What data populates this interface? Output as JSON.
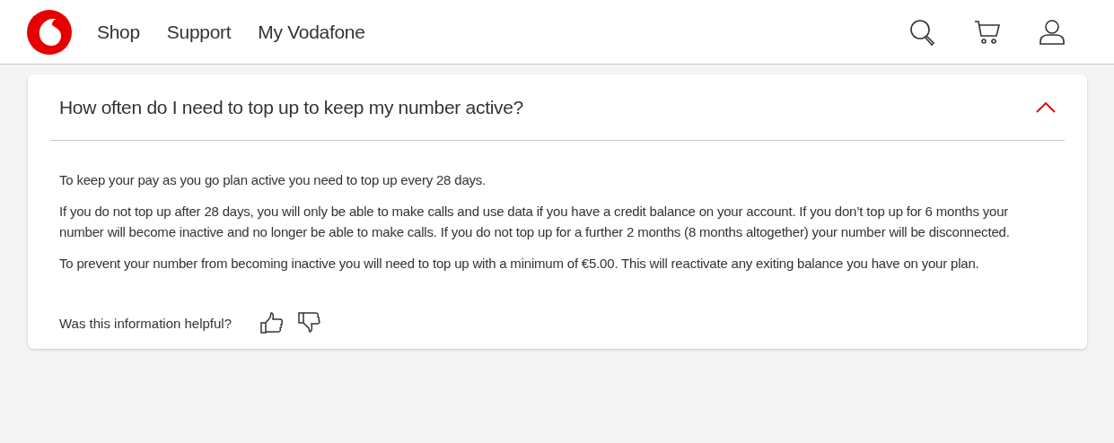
{
  "nav": {
    "links": [
      "Shop",
      "Support",
      "My Vodafone"
    ]
  },
  "faq": {
    "question": "How often do I need to top up to keep my number active?",
    "expanded": true,
    "paragraphs": [
      "To keep your pay as you go plan active you need to top up every 28 days.",
      "If you do not top up after 28 days, you will only be able to make calls and use data if you have a credit balance on your account. If you don’t top up for 6 months your number will become inactive and no longer be able to make calls. If you do not top up for a further 2 months (8 months altogether) your number will be disconnected.",
      "To prevent your number from becoming inactive you will need to top up with a minimum of €5.00. This will reactivate any exiting balance you have on your plan."
    ],
    "feedback": {
      "question": "Was this information helpful?"
    }
  }
}
